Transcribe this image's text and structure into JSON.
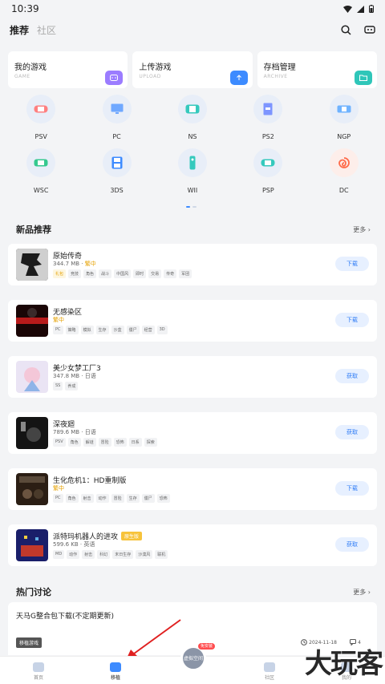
{
  "status": {
    "time": "10:39"
  },
  "header": {
    "tabs": [
      "推荐",
      "社区"
    ],
    "active_tab": "推荐"
  },
  "quick": [
    {
      "title": "我的游戏",
      "sub": "GAME",
      "color": "#9b7cff",
      "icon": "gamepad-icon"
    },
    {
      "title": "上传游戏",
      "sub": "UPLOAD",
      "color": "#3d8bff",
      "icon": "upload-cloud-icon"
    },
    {
      "title": "存档管理",
      "sub": "ARCHIVE",
      "color": "#2fc6b9",
      "icon": "folder-icon"
    }
  ],
  "platforms": [
    {
      "name": "PSV",
      "color": "#ff6b6b"
    },
    {
      "name": "PC",
      "color": "#3d8bff"
    },
    {
      "name": "NS",
      "color": "#2fc6b9"
    },
    {
      "name": "PS2",
      "color": "#5b7cff"
    },
    {
      "name": "NGP",
      "color": "#4ba3ff"
    },
    {
      "name": "WSC",
      "color": "#2fc68b"
    },
    {
      "name": "3DS",
      "color": "#3d8bff"
    },
    {
      "name": "WII",
      "color": "#2fc6b9"
    },
    {
      "name": "PSP",
      "color": "#2fc6b9"
    },
    {
      "name": "DC",
      "color": "#ff6b4a"
    }
  ],
  "new_section": {
    "title": "新品推荐",
    "more": "更多"
  },
  "games": [
    {
      "name": "原始传奇",
      "size": "344.7 MB",
      "lang": "",
      "lang_hl": "繁中",
      "badge": "",
      "tags": [
        "礼包",
        "竞技",
        "角色",
        "战斗",
        "中国风",
        "即时",
        "交易",
        "传奇",
        "军团"
      ],
      "hot_first": true,
      "button": "下载",
      "thumb": "#2a2a2a"
    },
    {
      "name": "无感染区",
      "size": "",
      "lang": "",
      "lang_hl": "繁中",
      "badge": "",
      "tags": [
        "PC",
        "策略",
        "模拟",
        "生存",
        "沙盒",
        "僵尸",
        "经营",
        "3D"
      ],
      "hot_first": false,
      "button": "下载",
      "thumb": "#5a1010"
    },
    {
      "name": "美少女梦工厂3",
      "size": "347.8 MB",
      "lang": "日语",
      "lang_hl": "",
      "badge": "",
      "tags": [
        "SS",
        "养成"
      ],
      "hot_first": false,
      "button": "获取",
      "thumb": "#d8cfe8"
    },
    {
      "name": "深夜廻",
      "size": "789.6 MB",
      "lang": "日语",
      "lang_hl": "",
      "badge": "",
      "tags": [
        "PSV",
        "角色",
        "解谜",
        "冒险",
        "恐怖",
        "日系",
        "探索"
      ],
      "hot_first": false,
      "button": "获取",
      "thumb": "#1c1c1c"
    },
    {
      "name": "生化危机1：HD重制版",
      "size": "",
      "lang": "",
      "lang_hl": "繁中",
      "badge": "",
      "tags": [
        "PC",
        "角色",
        "射击",
        "动作",
        "冒险",
        "生存",
        "僵尸",
        "恐怖"
      ],
      "hot_first": false,
      "button": "下载",
      "thumb": "#2b1e14"
    },
    {
      "name": "派特玛机器人的进攻",
      "size": "599.6 KB",
      "lang": "英语",
      "lang_hl": "",
      "badge": "原生版",
      "tags": [
        "MD",
        "动作",
        "射击",
        "科幻",
        "末日生存",
        "沙漠风",
        "联机"
      ],
      "hot_first": false,
      "button": "获取",
      "thumb": "#1a1f6a"
    }
  ],
  "hot_section": {
    "title": "热门讨论",
    "more": "更多"
  },
  "discussion": {
    "title": "天马G整合包下载(不定期更新)",
    "tag": "移植游戏",
    "date": "2024-11-18",
    "count": "4"
  },
  "nav": [
    {
      "label": "首页",
      "active": false
    },
    {
      "label": "移植",
      "active": true
    },
    {
      "label": "",
      "active": false
    },
    {
      "label": "社区",
      "active": false
    },
    {
      "label": "我的",
      "active": false
    }
  ],
  "center": {
    "text": "虚拟空间",
    "badge": "免安装"
  },
  "watermark": "大玩客"
}
